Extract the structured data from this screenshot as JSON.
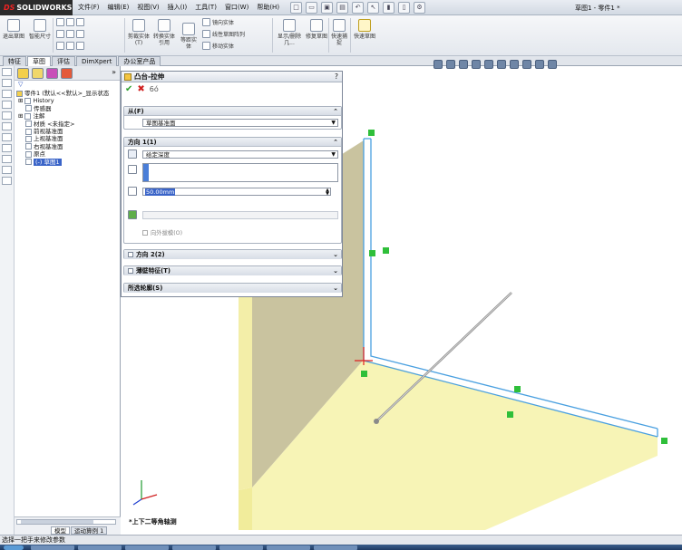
{
  "app": {
    "logo": "SOLIDWORKS",
    "logo_mark": "DS",
    "document_title": "草图1 - 零件1 *"
  },
  "menu": [
    "文件(F)",
    "编辑(E)",
    "视图(V)",
    "插入(I)",
    "工具(T)",
    "窗口(W)",
    "帮助(H)"
  ],
  "ribbon": {
    "exit_sketch": "退出草图",
    "smart_dimension": "智能尺寸",
    "trim_entities": "剪裁实体(T)",
    "convert_entities": "转换实体引用",
    "offset_entities": "等距实体",
    "mirror_entities": "镜向实体",
    "linear_pattern": "线性草图阵列",
    "move_entities": "移动实体",
    "display_relations": "显示/删除几...",
    "repair_sketch": "修复草图",
    "quick_snaps": "快速捕捉",
    "rapid_sketch": "快速草图"
  },
  "tabs": [
    "特征",
    "草图",
    "评估",
    "DimXpert",
    "办公室产品"
  ],
  "active_tab": 1,
  "tree": {
    "root": "零件1 (默认<<默认>_显示状态",
    "items": [
      "History",
      "传感器",
      "注解",
      "材质 <未指定>",
      "前视基准面",
      "上视基准面",
      "右视基准面",
      "原点",
      "(-) 草图1"
    ],
    "selected_index": 8,
    "bottom_tabs": [
      "模型",
      "运动算例 1"
    ]
  },
  "property_manager": {
    "title": "凸台-拉伸",
    "help": "?",
    "from": {
      "header": "从(F)",
      "value": "草图基准面"
    },
    "direction1": {
      "header": "方向 1(1)",
      "end_condition": "给定深度",
      "depth": "50.00mm",
      "draft_outward": "向外拔模(O)"
    },
    "direction2": {
      "header": "方向 2(2)"
    },
    "thin_feature": {
      "header": "薄壁特征(T)"
    },
    "selected_contours": {
      "header": "所选轮廓(S)"
    }
  },
  "viewport": {
    "view_label": "*上下二等角轴测"
  },
  "status_bar": "选择一把手来修改参数",
  "colors": {
    "face": "#f7f4b6",
    "side_face": "#c9c39f",
    "sketch_edge": "#4aa0e0",
    "marker": "#2fbf3a"
  }
}
